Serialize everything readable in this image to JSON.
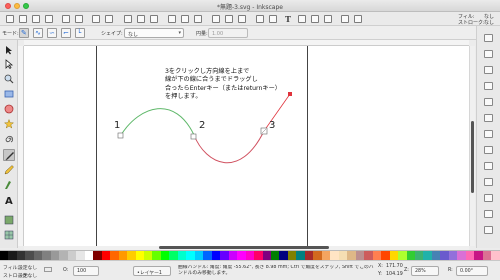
{
  "window": {
    "title": "*無題-3.svg - Inkscape"
  },
  "top_right": {
    "fill_label": "フィル:",
    "fill_value": "なし",
    "stroke_label": "ストローク:",
    "stroke_value": "なし"
  },
  "tool_controls": {
    "mode_label": "モード:",
    "shape_label": "シェイプ:",
    "shape_value": "なし",
    "width_label": "円量:",
    "width_value": "1.00"
  },
  "canvas": {
    "instruction_lines": [
      "3をクリックし方向線を上まで",
      "線が下の線に合うまでドラッグし",
      "合ったらEnterキー（またはreturnキー）",
      "を押します。"
    ],
    "node_labels": [
      "1",
      "2",
      "3"
    ],
    "curve_colors": {
      "first_segment": "#5fb86a",
      "second_segment": "#d0505f",
      "handle": "#e0333c"
    }
  },
  "statusbar": {
    "fill_label": "フィル:",
    "fill_value": "設定なし",
    "stroke_label": "ストローク:",
    "stroke_value": "設定なし",
    "opacity_label": "O:",
    "opacity_value": "100",
    "layer_value": "•レイヤー1",
    "message": "曲線ハンドル: 角度: 角度 -55.62°, 長さ 8.98 mm; Ctrl で角度をスナップ, Shift でこのハンドルのみ移動します。",
    "x_label": "X:",
    "x_value": "171.70",
    "y_label": "Y:",
    "y_value": "104.19",
    "zoom_label": "Z:",
    "zoom_value": "28%",
    "rotate_label": "R:",
    "rotate_value": "0.00°"
  },
  "palette_colors": [
    "#000000",
    "#1a1a1a",
    "#333333",
    "#4d4d4d",
    "#666666",
    "#808080",
    "#999999",
    "#b3b3b3",
    "#cccccc",
    "#e6e6e6",
    "#ffffff",
    "#800000",
    "#ff0000",
    "#ff6600",
    "#ff9900",
    "#ffcc00",
    "#ffff00",
    "#ccff00",
    "#66ff00",
    "#00ff00",
    "#00ff66",
    "#00ffcc",
    "#00ffff",
    "#00ccff",
    "#0066ff",
    "#0000ff",
    "#6600ff",
    "#cc00ff",
    "#ff00ff",
    "#ff00cc",
    "#ff0066",
    "#800080",
    "#008000",
    "#000080",
    "#808000",
    "#008080",
    "#a52a2a",
    "#d2691e",
    "#f4a460",
    "#ffe4c4",
    "#f5deb3",
    "#deb887",
    "#bc8f8f",
    "#cd5c5c",
    "#ff7f50",
    "#ff4500",
    "#ffd700",
    "#adff2f",
    "#32cd32",
    "#3cb371",
    "#20b2aa",
    "#4682b4",
    "#6a5acd",
    "#9370db",
    "#da70d6",
    "#ff69b4",
    "#c71585",
    "#db7093",
    "#ffc0cb"
  ]
}
